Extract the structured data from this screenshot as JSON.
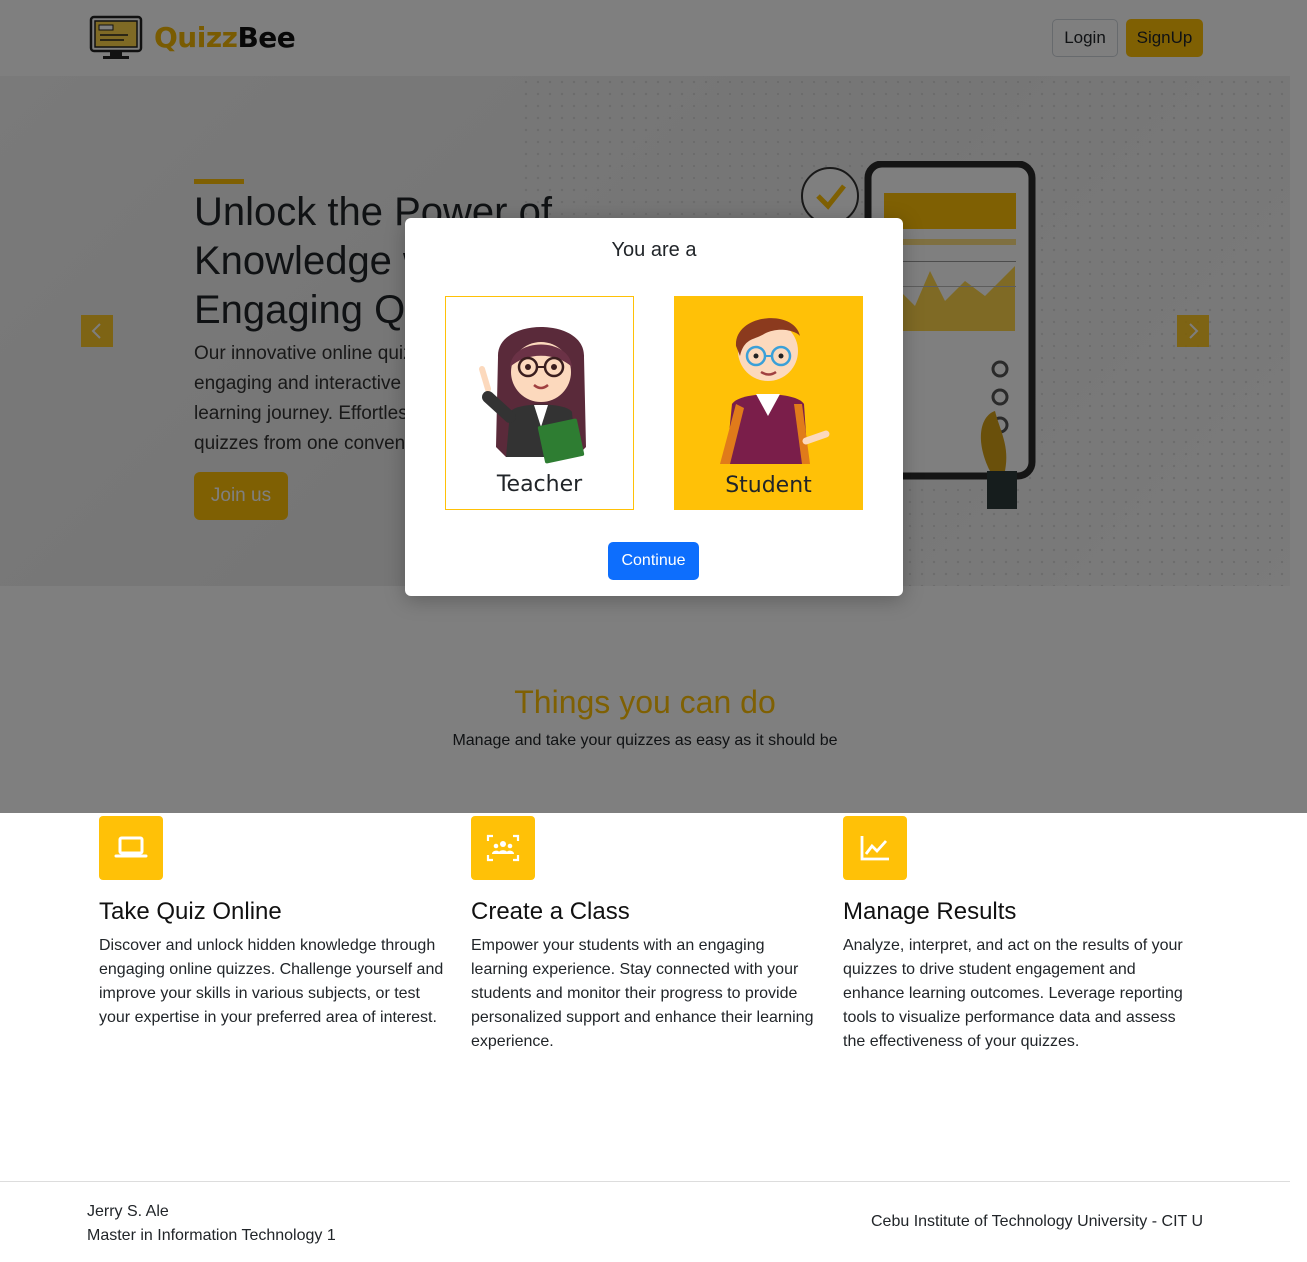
{
  "brand": {
    "name_part1": "Quizz",
    "name_part2": "Bee"
  },
  "nav": {
    "login": "Login",
    "signup": "SignUp"
  },
  "hero": {
    "title": "Unlock the Power of Knowledge with Engaging Quizzes",
    "description": "Our innovative online quiz platform provides an engaging and interactive way to enhance your learning journey. Effortlessly create and take quizzes from one convenient place.",
    "cta": "Join us"
  },
  "things": {
    "title": "Things you can do",
    "subtitle": "Manage and take your quizzes as easy as it should be"
  },
  "features": [
    {
      "title": "Take Quiz Online",
      "icon": "laptop-icon",
      "text": "Discover and unlock hidden knowledge through engaging online quizzes. Challenge yourself and improve your skills in various subjects, or test your expertise in your preferred area of interest."
    },
    {
      "title": "Create a Class",
      "icon": "class-group-icon",
      "text": "Empower your students with an engaging learning experience. Stay connected with your students and monitor their progress to provide personalized support and enhance their learning experience."
    },
    {
      "title": "Manage Results",
      "icon": "line-chart-icon",
      "text": "Analyze, interpret, and act on the results of your quizzes to drive student engagement and enhance learning outcomes. Leverage reporting tools to visualize performance data and assess the effectiveness of your quizzes."
    }
  ],
  "footer": {
    "name": "Jerry S. Ale",
    "program": "Master in Information Technology 1",
    "school": "Cebu Institute of Technology University - CIT U"
  },
  "modal": {
    "title": "You are a",
    "teacher_label": "Teacher",
    "student_label": "Student",
    "continue": "Continue"
  },
  "colors": {
    "accent": "#ffc107",
    "primary": "#0d6efd"
  }
}
